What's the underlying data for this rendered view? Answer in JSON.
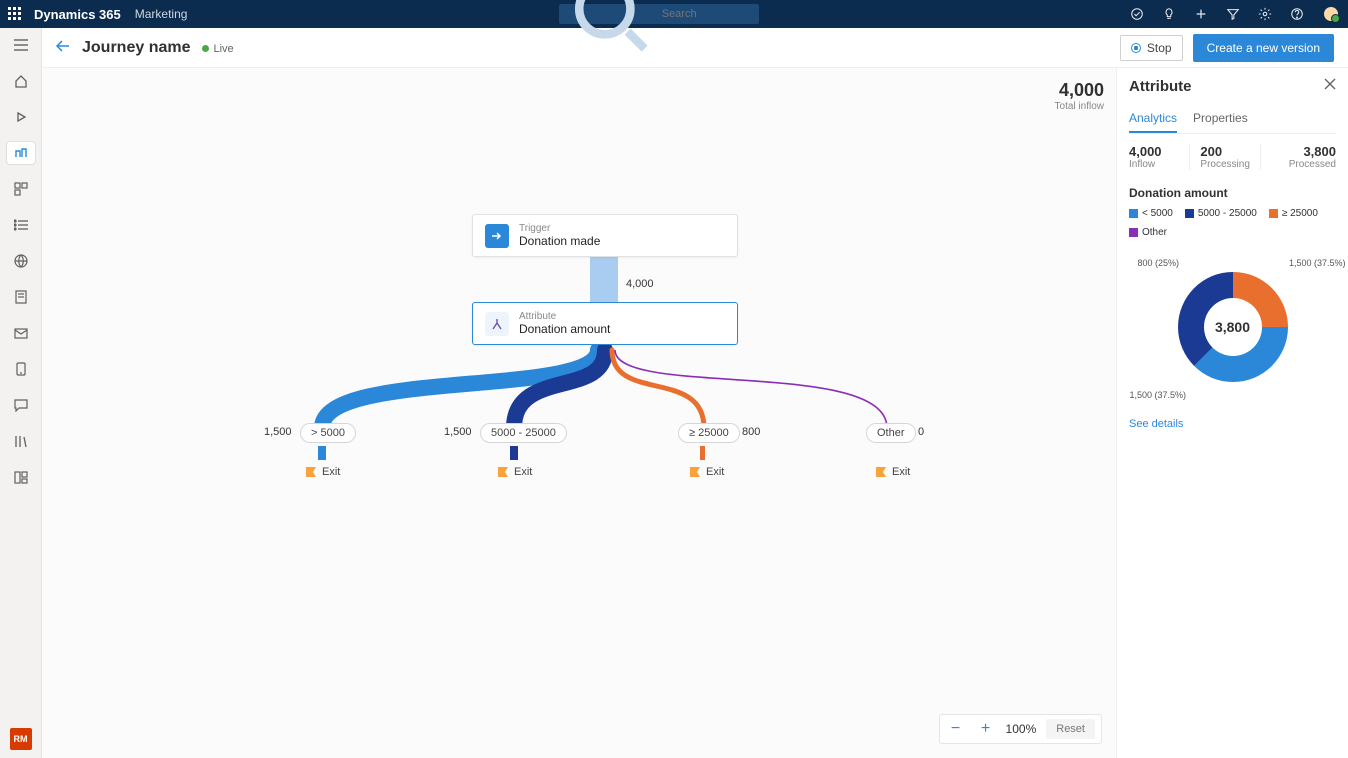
{
  "top": {
    "brand": "Dynamics 365",
    "area": "Marketing",
    "search_placeholder": "Search"
  },
  "header": {
    "title": "Journey name",
    "status": "Live",
    "stop": "Stop",
    "primary": "Create a new version"
  },
  "inflow": {
    "value": "4,000",
    "label": "Total inflow"
  },
  "nodes": {
    "trigger": {
      "label": "Trigger",
      "name": "Donation made"
    },
    "attribute": {
      "label": "Attribute",
      "name": "Donation amount"
    },
    "flow": "4,000"
  },
  "branches": [
    {
      "label": "> 5000",
      "count": "1,500",
      "color": "#2b88d8"
    },
    {
      "label": "5000 - 25000",
      "count": "1,500",
      "color": "#1b3a93"
    },
    {
      "label": "≥ 25000",
      "count": "800",
      "color": "#e86f2e"
    },
    {
      "label": "Other",
      "count": "0",
      "color": "#8a2fb3"
    }
  ],
  "exit": "Exit",
  "panel": {
    "title": "Attribute",
    "tabs": [
      "Analytics",
      "Properties"
    ],
    "stats": [
      {
        "v": "4,000",
        "l": "Inflow"
      },
      {
        "v": "200",
        "l": "Processing"
      },
      {
        "v": "3,800",
        "l": "Processed"
      }
    ],
    "section": "Donation amount",
    "legend": [
      {
        "c": "#2b88d8",
        "t": "< 5000"
      },
      {
        "c": "#1b3a93",
        "t": "5000 - 25000"
      },
      {
        "c": "#e86f2e",
        "t": "≥ 25000"
      },
      {
        "c": "#8a2fb3",
        "t": "Other"
      }
    ],
    "donut_center": "3,800",
    "donut_labels": {
      "a": "800 (25%)",
      "b": "1,500 (37.5%)",
      "c": "1,500 (37.5%)"
    },
    "see": "See details"
  },
  "zoom": {
    "level": "100%",
    "reset": "Reset"
  },
  "persona": "RM",
  "chart_data": {
    "type": "pie",
    "title": "Donation amount",
    "series": [
      {
        "name": "< 5000",
        "value": 1500,
        "pct": 37.5,
        "color": "#2b88d8"
      },
      {
        "name": "5000 - 25000",
        "value": 1500,
        "pct": 37.5,
        "color": "#1b3a93"
      },
      {
        "name": "≥ 25000",
        "value": 800,
        "pct": 25.0,
        "color": "#e86f2e"
      },
      {
        "name": "Other",
        "value": 0,
        "pct": 0,
        "color": "#8a2fb3"
      }
    ],
    "total": 3800
  }
}
